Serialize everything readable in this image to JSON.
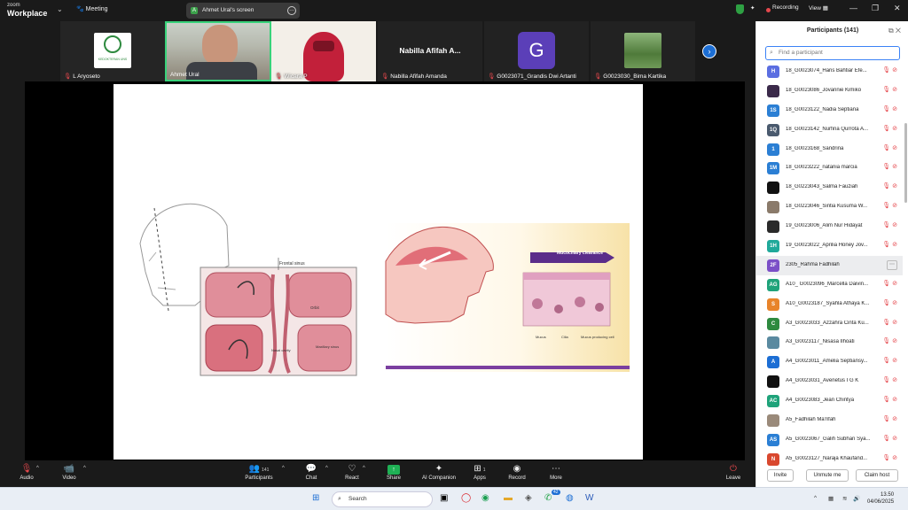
{
  "titlebar": {
    "brand_line1": "zoom",
    "brand_line2": "Workplace",
    "meeting_label": "Meeting",
    "screen_share_label": "Ahmet Ural's screen",
    "screen_share_avatar": "A",
    "recording_label": "Recording",
    "view_label": "View"
  },
  "video_strip": {
    "tiles": [
      {
        "name": "L Aryoseto",
        "logo_text": "KEDOKTERAN UNS"
      },
      {
        "name": "Ahmet Ural"
      },
      {
        "name": "Wicara P"
      },
      {
        "name": "Nabilla Afifah Amanda",
        "big_label": "Nabilla Afifah A..."
      },
      {
        "name": "G0023071_Grandis Dwi Artanti",
        "initial": "G"
      },
      {
        "name": "G0023030_Bima Kartika"
      }
    ]
  },
  "slide": {
    "left_label_top": "Frontal sinus",
    "left_label_orbit": "Orbit",
    "left_label_nasal": "Nasal cavity",
    "left_label_maxillary": "Maxillary sinus",
    "banner": "Mucociliary clearance",
    "label_mucus": "Mucus",
    "label_cilia": "Cilia",
    "label_mucus_cell": "Mucus producing cell"
  },
  "toolbar": {
    "audio": "Audio",
    "video": "Video",
    "participants": "Participants",
    "participants_count": "141",
    "chat": "Chat",
    "react": "React",
    "share": "Share",
    "ai": "AI Companion",
    "apps": "Apps",
    "apps_count": "1",
    "record": "Record",
    "more": "More",
    "leave": "Leave"
  },
  "participants_panel": {
    "title": "Participants (141)",
    "search_placeholder": "Find a participant",
    "rows": [
      {
        "initials": "H",
        "color": "#5b6ee1",
        "name": "18_G0023074_Haris Bahtiar Efe..."
      },
      {
        "initials": "",
        "color": "#3b2a4a",
        "name": "18_G0023086_Jovannie Kimiko"
      },
      {
        "initials": "1S",
        "color": "#2b7fd4",
        "name": "18_G0023122_Nadia Septiana"
      },
      {
        "initials": "1Q",
        "color": "#4a5a6e",
        "name": "18_G0023142_Nurfina Qurrota A..."
      },
      {
        "initials": "1",
        "color": "#2b7fd4",
        "name": "18_G0023168_Sandrina"
      },
      {
        "initials": "1M",
        "color": "#2b7fd4",
        "name": "18_G0023222_natania marcia"
      },
      {
        "initials": "",
        "color": "#111111",
        "name": "18_G0223043_Salma Fauziah"
      },
      {
        "initials": "",
        "color": "#8a7a6a",
        "name": "18_G0223046_Sintia Kusuma W..."
      },
      {
        "initials": "",
        "color": "#2a2a2a",
        "name": "19_G0023006_Alim Nur Hidayat"
      },
      {
        "initials": "1H",
        "color": "#20a99a",
        "name": "19_G0023022_Aprilia Honey Jov..."
      },
      {
        "initials": "2F",
        "color": "#7b4fc7",
        "name": "2305_Rahma Fadhilah",
        "highlight": true
      },
      {
        "initials": "AG",
        "color": "#1fa37a",
        "name": "A10_ G0023096_Marcella Daivin..."
      },
      {
        "initials": "S",
        "color": "#e8842a",
        "name": "A10_G0023187_Syahla Athaya K..."
      },
      {
        "initials": "C",
        "color": "#2e8a3f",
        "name": "A3_G0023033_Azzahra Cinta Ku..."
      },
      {
        "initials": "",
        "color": "#5a8aa0",
        "name": "A3_G0023117_Nisasa Ilhoati"
      },
      {
        "initials": "A",
        "color": "#1c6ed4",
        "name": "A4_G0023011_Amelia Septiansy..."
      },
      {
        "initials": "",
        "color": "#111111",
        "name": "A4_G0023031_Avenetus I G K"
      },
      {
        "initials": "AC",
        "color": "#1fa37a",
        "name": "A4_G0023083_Jean Chintya"
      },
      {
        "initials": "",
        "color": "#9a8a7a",
        "name": "A5_Fadhilah Ma'rifah"
      },
      {
        "initials": "AS",
        "color": "#2b7fd4",
        "name": "A5_G0023067_Galih Subhan Sya..."
      },
      {
        "initials": "N",
        "color": "#d9482f",
        "name": "A5_G0023127_Naraja Khaufand..."
      }
    ],
    "invite": "Invite",
    "unmute_me": "Unmute me",
    "claim_host": "Claim host"
  },
  "taskbar": {
    "search_label": "Search",
    "time": "13.50",
    "date": "04/06/2025",
    "chat_badge": "42"
  },
  "icons": [
    "search-icon",
    "mic-off-icon",
    "video-off-icon",
    "shield-icon",
    "sparkle-icon",
    "windows-start-icon"
  ]
}
